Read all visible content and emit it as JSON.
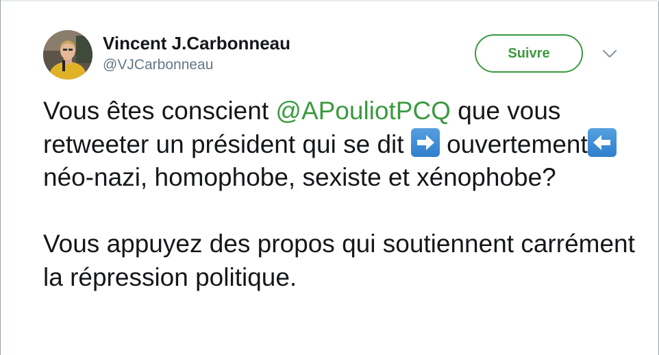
{
  "author": {
    "name": "Vincent J.Carbonneau",
    "handle": "@VJCarbonneau"
  },
  "actions": {
    "follow_label": "Suivre"
  },
  "tweet": {
    "p1_part1": "Vous êtes conscient ",
    "mention": "@APouliotPCQ",
    "p1_part2": " que vous retweeter un président qui se dit ",
    "p1_part3": "ouvertement",
    "p1_part4": " néo-nazi, homophobe, sexiste et xénophobe?",
    "paragraph2": "Vous appuyez des propos qui soutiennent carrément la répression politique."
  },
  "icons": {
    "emoji_right": "right-arrow-emoji",
    "emoji_left": "left-arrow-emoji",
    "more": "chevron-down-icon"
  },
  "colors": {
    "accent_green": "#3a9a3e",
    "text": "#14171a",
    "muted": "#657786",
    "emoji_blue": "#3d8ad6"
  }
}
